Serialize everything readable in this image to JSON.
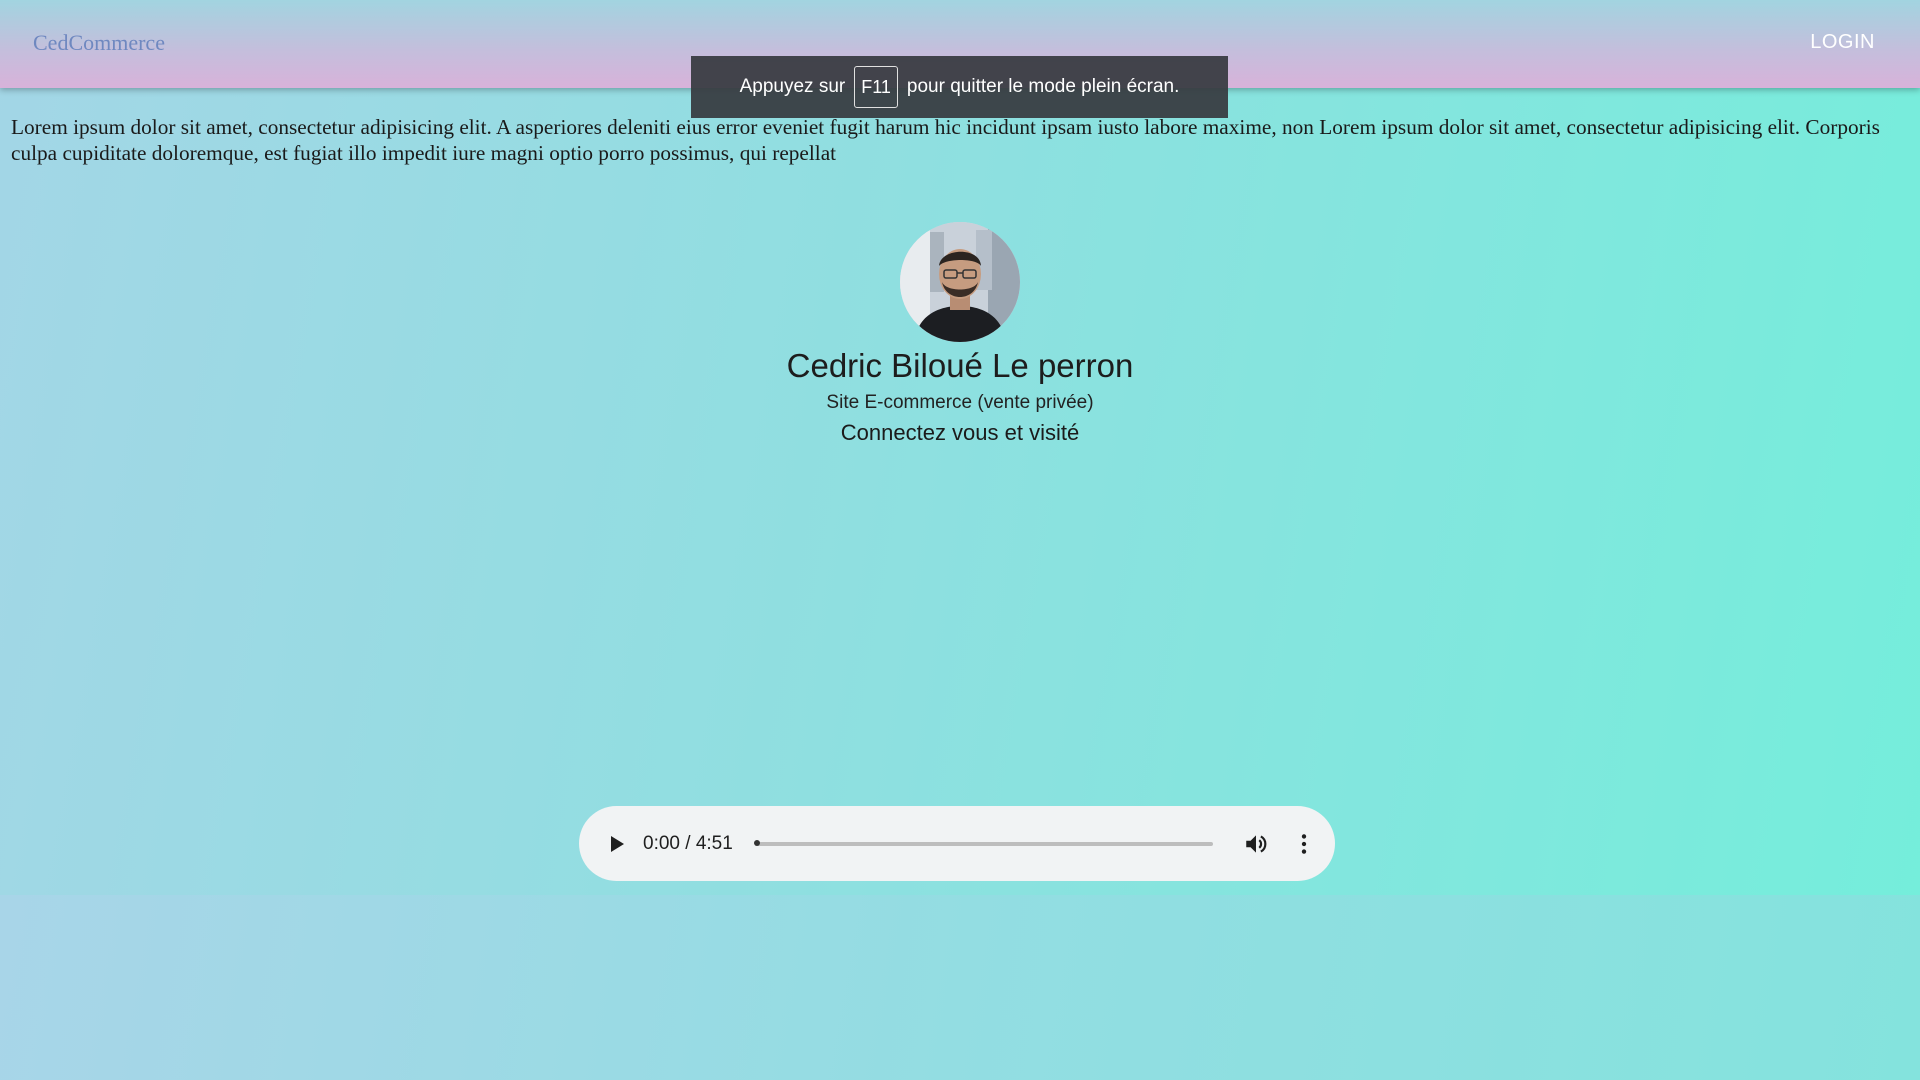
{
  "header": {
    "brand": "CedCommerce",
    "login_label": "LOGIN"
  },
  "fullscreen_notice": {
    "before": "Appuyez sur",
    "key": "F11",
    "after": "pour quitter le mode plein écran."
  },
  "intro": {
    "text": "Lorem ipsum dolor sit amet, consectetur adipisicing elit. A asperiores deleniti eius error eveniet fugit harum hic incidunt ipsam iusto labore maxime, non Lorem ipsum dolor sit amet, consectetur adipisicing elit. Corporis culpa cupiditate doloremque, est fugiat illo impedit iure magni optio porro possimus, qui repellat"
  },
  "profile": {
    "name": "Cedric Biloué Le perron",
    "subtitle": "Site E-commerce (vente privée)",
    "cta": "Connectez vous et visité"
  },
  "audio_player": {
    "current_time": "0:00",
    "duration": "4:51",
    "time_display": "0:00 / 4:51",
    "progress": 0,
    "icons": {
      "play": "play-icon",
      "volume": "volume-icon",
      "more": "more-options-icon"
    }
  },
  "colors": {
    "brand_text": "#6f88c0",
    "header_gradient_top": "#a2d4e0",
    "header_gradient_bottom": "#d8b2da",
    "page_gradient_left": "#a3d6e6",
    "page_gradient_right": "#74eedb",
    "player_bg": "#f1f3f4",
    "toast_bg": "#373a40"
  }
}
